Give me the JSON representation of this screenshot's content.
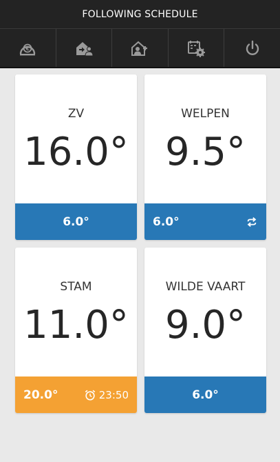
{
  "header": {
    "title": "FOLLOWING SCHEDULE"
  },
  "toolbar": {
    "items": [
      {
        "icon": "euro-dashboard-icon"
      },
      {
        "icon": "home-arrow-user-icon"
      },
      {
        "icon": "home-user-add-icon"
      },
      {
        "icon": "schedule-settings-icon"
      },
      {
        "icon": "power-icon"
      }
    ]
  },
  "zones": [
    {
      "name": "ZV",
      "temperature": "16.0°",
      "setpoint": "6.0°",
      "status_color": "#2878b6"
    },
    {
      "name": "WELPEN",
      "temperature": "9.5°",
      "setpoint": "6.0°",
      "status_color": "#2878b6",
      "indicator": "repeat-icon"
    },
    {
      "name": "STAM",
      "temperature": "11.0°",
      "setpoint": "20.0°",
      "status_color": "#f4a133",
      "indicator": "alarm-clock-icon",
      "until": "23:50"
    },
    {
      "name": "WILDE VAART",
      "temperature": "9.0°",
      "setpoint": "6.0°",
      "status_color": "#2878b6"
    }
  ]
}
